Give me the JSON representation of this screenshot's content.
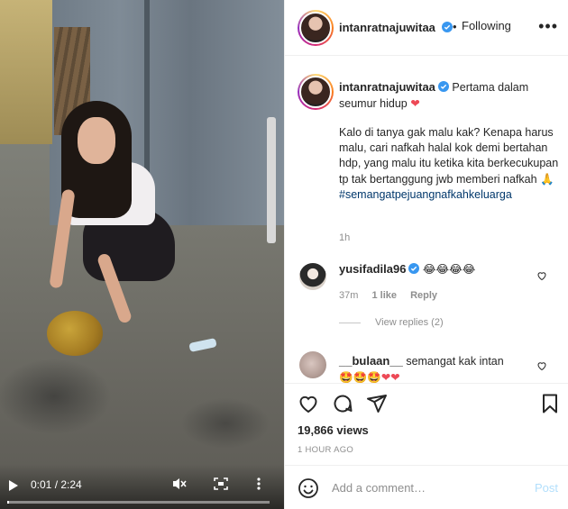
{
  "post": {
    "author": "intanratnajuwitaa",
    "follow_status": "Following",
    "dot": "•",
    "more": "•••"
  },
  "caption": {
    "username": "intanratnajuwitaa",
    "headline": "Pertama dalam seumur hidup",
    "heart": "❤",
    "body": "Kalo di tanya gak malu kak? Kenapa harus malu, cari nafkah halal kok demi bertahan hdp, yang malu itu ketika kita berkecukupan tp tak bertanggung jwb memberi nafkah",
    "emoji": "🙏",
    "hashtag": "#semangatpejuangnafkahkeluarga",
    "time": "1h"
  },
  "comments": [
    {
      "username": "yusifadila96",
      "text": "😂😂😂😂",
      "time": "37m",
      "likes": "1 like",
      "reply": "Reply",
      "view_replies": "View replies (2)"
    },
    {
      "username": "__bulaan__",
      "text": "semangat kak intan",
      "emojis": "🤩🤩🤩❤❤"
    }
  ],
  "stats": {
    "views": "19,866 views",
    "posted": "1 HOUR AGO"
  },
  "add_comment": {
    "placeholder": "Add a comment…",
    "post_label": "Post"
  },
  "video": {
    "time": "0:01 / 2:24",
    "progress": 0.007
  },
  "colors": {
    "link": "#00376b",
    "verified": "#3897f0",
    "heart": "#ed4956"
  }
}
